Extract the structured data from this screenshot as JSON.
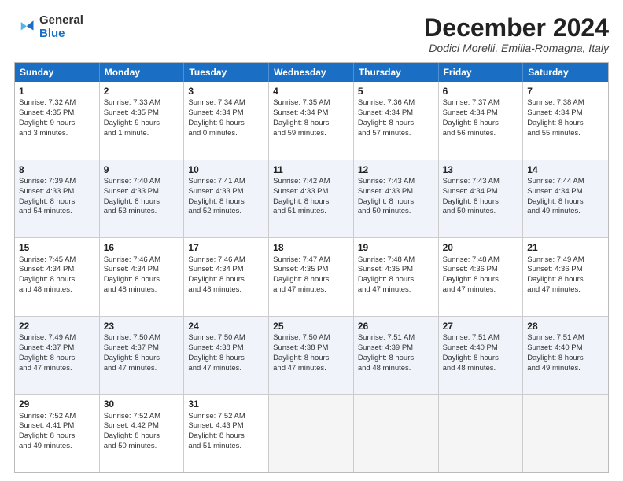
{
  "logo": {
    "general": "General",
    "blue": "Blue"
  },
  "header": {
    "month": "December 2024",
    "location": "Dodici Morelli, Emilia-Romagna, Italy"
  },
  "days": [
    "Sunday",
    "Monday",
    "Tuesday",
    "Wednesday",
    "Thursday",
    "Friday",
    "Saturday"
  ],
  "rows": [
    [
      {
        "day": "1",
        "lines": [
          "Sunrise: 7:32 AM",
          "Sunset: 4:35 PM",
          "Daylight: 9 hours",
          "and 3 minutes."
        ]
      },
      {
        "day": "2",
        "lines": [
          "Sunrise: 7:33 AM",
          "Sunset: 4:35 PM",
          "Daylight: 9 hours",
          "and 1 minute."
        ]
      },
      {
        "day": "3",
        "lines": [
          "Sunrise: 7:34 AM",
          "Sunset: 4:34 PM",
          "Daylight: 9 hours",
          "and 0 minutes."
        ]
      },
      {
        "day": "4",
        "lines": [
          "Sunrise: 7:35 AM",
          "Sunset: 4:34 PM",
          "Daylight: 8 hours",
          "and 59 minutes."
        ]
      },
      {
        "day": "5",
        "lines": [
          "Sunrise: 7:36 AM",
          "Sunset: 4:34 PM",
          "Daylight: 8 hours",
          "and 57 minutes."
        ]
      },
      {
        "day": "6",
        "lines": [
          "Sunrise: 7:37 AM",
          "Sunset: 4:34 PM",
          "Daylight: 8 hours",
          "and 56 minutes."
        ]
      },
      {
        "day": "7",
        "lines": [
          "Sunrise: 7:38 AM",
          "Sunset: 4:34 PM",
          "Daylight: 8 hours",
          "and 55 minutes."
        ]
      }
    ],
    [
      {
        "day": "8",
        "lines": [
          "Sunrise: 7:39 AM",
          "Sunset: 4:33 PM",
          "Daylight: 8 hours",
          "and 54 minutes."
        ]
      },
      {
        "day": "9",
        "lines": [
          "Sunrise: 7:40 AM",
          "Sunset: 4:33 PM",
          "Daylight: 8 hours",
          "and 53 minutes."
        ]
      },
      {
        "day": "10",
        "lines": [
          "Sunrise: 7:41 AM",
          "Sunset: 4:33 PM",
          "Daylight: 8 hours",
          "and 52 minutes."
        ]
      },
      {
        "day": "11",
        "lines": [
          "Sunrise: 7:42 AM",
          "Sunset: 4:33 PM",
          "Daylight: 8 hours",
          "and 51 minutes."
        ]
      },
      {
        "day": "12",
        "lines": [
          "Sunrise: 7:43 AM",
          "Sunset: 4:33 PM",
          "Daylight: 8 hours",
          "and 50 minutes."
        ]
      },
      {
        "day": "13",
        "lines": [
          "Sunrise: 7:43 AM",
          "Sunset: 4:34 PM",
          "Daylight: 8 hours",
          "and 50 minutes."
        ]
      },
      {
        "day": "14",
        "lines": [
          "Sunrise: 7:44 AM",
          "Sunset: 4:34 PM",
          "Daylight: 8 hours",
          "and 49 minutes."
        ]
      }
    ],
    [
      {
        "day": "15",
        "lines": [
          "Sunrise: 7:45 AM",
          "Sunset: 4:34 PM",
          "Daylight: 8 hours",
          "and 48 minutes."
        ]
      },
      {
        "day": "16",
        "lines": [
          "Sunrise: 7:46 AM",
          "Sunset: 4:34 PM",
          "Daylight: 8 hours",
          "and 48 minutes."
        ]
      },
      {
        "day": "17",
        "lines": [
          "Sunrise: 7:46 AM",
          "Sunset: 4:34 PM",
          "Daylight: 8 hours",
          "and 48 minutes."
        ]
      },
      {
        "day": "18",
        "lines": [
          "Sunrise: 7:47 AM",
          "Sunset: 4:35 PM",
          "Daylight: 8 hours",
          "and 47 minutes."
        ]
      },
      {
        "day": "19",
        "lines": [
          "Sunrise: 7:48 AM",
          "Sunset: 4:35 PM",
          "Daylight: 8 hours",
          "and 47 minutes."
        ]
      },
      {
        "day": "20",
        "lines": [
          "Sunrise: 7:48 AM",
          "Sunset: 4:36 PM",
          "Daylight: 8 hours",
          "and 47 minutes."
        ]
      },
      {
        "day": "21",
        "lines": [
          "Sunrise: 7:49 AM",
          "Sunset: 4:36 PM",
          "Daylight: 8 hours",
          "and 47 minutes."
        ]
      }
    ],
    [
      {
        "day": "22",
        "lines": [
          "Sunrise: 7:49 AM",
          "Sunset: 4:37 PM",
          "Daylight: 8 hours",
          "and 47 minutes."
        ]
      },
      {
        "day": "23",
        "lines": [
          "Sunrise: 7:50 AM",
          "Sunset: 4:37 PM",
          "Daylight: 8 hours",
          "and 47 minutes."
        ]
      },
      {
        "day": "24",
        "lines": [
          "Sunrise: 7:50 AM",
          "Sunset: 4:38 PM",
          "Daylight: 8 hours",
          "and 47 minutes."
        ]
      },
      {
        "day": "25",
        "lines": [
          "Sunrise: 7:50 AM",
          "Sunset: 4:38 PM",
          "Daylight: 8 hours",
          "and 47 minutes."
        ]
      },
      {
        "day": "26",
        "lines": [
          "Sunrise: 7:51 AM",
          "Sunset: 4:39 PM",
          "Daylight: 8 hours",
          "and 48 minutes."
        ]
      },
      {
        "day": "27",
        "lines": [
          "Sunrise: 7:51 AM",
          "Sunset: 4:40 PM",
          "Daylight: 8 hours",
          "and 48 minutes."
        ]
      },
      {
        "day": "28",
        "lines": [
          "Sunrise: 7:51 AM",
          "Sunset: 4:40 PM",
          "Daylight: 8 hours",
          "and 49 minutes."
        ]
      }
    ],
    [
      {
        "day": "29",
        "lines": [
          "Sunrise: 7:52 AM",
          "Sunset: 4:41 PM",
          "Daylight: 8 hours",
          "and 49 minutes."
        ]
      },
      {
        "day": "30",
        "lines": [
          "Sunrise: 7:52 AM",
          "Sunset: 4:42 PM",
          "Daylight: 8 hours",
          "and 50 minutes."
        ]
      },
      {
        "day": "31",
        "lines": [
          "Sunrise: 7:52 AM",
          "Sunset: 4:43 PM",
          "Daylight: 8 hours",
          "and 51 minutes."
        ]
      },
      {
        "day": "",
        "lines": []
      },
      {
        "day": "",
        "lines": []
      },
      {
        "day": "",
        "lines": []
      },
      {
        "day": "",
        "lines": []
      }
    ]
  ]
}
